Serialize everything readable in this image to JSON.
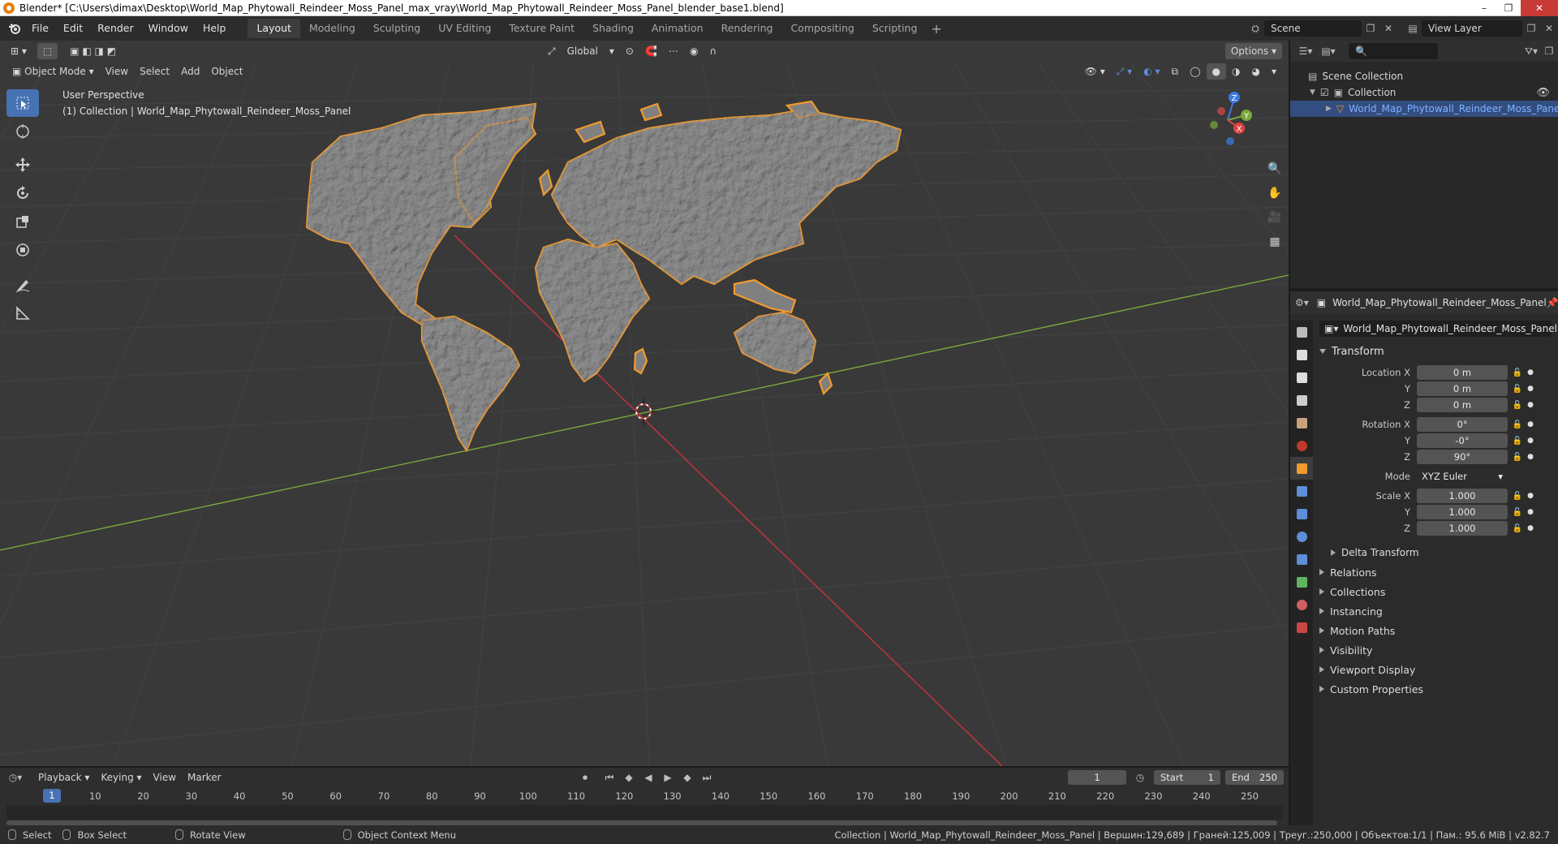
{
  "window": {
    "title": "Blender* [C:\\Users\\dimax\\Desktop\\World_Map_Phytowall_Reindeer_Moss_Panel_max_vray\\World_Map_Phytowall_Reindeer_Moss_Panel_blender_base1.blend]",
    "controls": [
      "–",
      "❐",
      "✕"
    ]
  },
  "menu": [
    "File",
    "Edit",
    "Render",
    "Window",
    "Help"
  ],
  "workspaces": [
    "Layout",
    "Modeling",
    "Sculpting",
    "UV Editing",
    "Texture Paint",
    "Shading",
    "Animation",
    "Rendering",
    "Compositing",
    "Scripting"
  ],
  "active_workspace": "Layout",
  "scene": {
    "name": "Scene",
    "view_layer": "View Layer"
  },
  "viewport": {
    "mode": "Object Mode",
    "menus": [
      "View",
      "Select",
      "Add",
      "Object"
    ],
    "orientation": "Global",
    "options_label": "Options",
    "perspective_label": "User Perspective",
    "collection_label": "(1) Collection | World_Map_Phytowall_Reindeer_Moss_Panel",
    "gizmo": {
      "x": "X",
      "y": "Y",
      "z": "Z"
    }
  },
  "outliner": {
    "scene_collection": "Scene Collection",
    "collection": "Collection",
    "object": "World_Map_Phytowall_Reindeer_Moss_Panel"
  },
  "properties": {
    "header_name": "World_Map_Phytowall_Reindeer_Moss_Panel",
    "object_name": "World_Map_Phytowall_Reindeer_Moss_Panel",
    "transform_title": "Transform",
    "location": {
      "label": "Location X",
      "x": "0 m",
      "y": "0 m",
      "z": "0 m"
    },
    "rotation": {
      "label": "Rotation X",
      "x": "0°",
      "y": "-0°",
      "z": "90°"
    },
    "mode": {
      "label": "Mode",
      "value": "XYZ Euler"
    },
    "scale": {
      "label": "Scale X",
      "x": "1.000",
      "y": "1.000",
      "z": "1.000"
    },
    "axis_y": "Y",
    "axis_z": "Z",
    "delta_transform": "Delta Transform",
    "panels": [
      "Relations",
      "Collections",
      "Instancing",
      "Motion Paths",
      "Visibility",
      "Viewport Display",
      "Custom Properties"
    ]
  },
  "timeline": {
    "menus": [
      "Playback",
      "Keying",
      "View",
      "Marker"
    ],
    "current_frame": "1",
    "start_label": "Start",
    "start": "1",
    "end_label": "End",
    "end": "250",
    "ruler": [
      "1",
      "10",
      "20",
      "30",
      "40",
      "50",
      "60",
      "70",
      "80",
      "90",
      "100",
      "110",
      "120",
      "130",
      "140",
      "150",
      "160",
      "170",
      "180",
      "190",
      "200",
      "210",
      "220",
      "230",
      "240",
      "250"
    ]
  },
  "statusbar": {
    "select": "Select",
    "box_select": "Box Select",
    "rotate_view": "Rotate View",
    "context_menu": "Object Context Menu",
    "stats": "Collection | World_Map_Phytowall_Reindeer_Moss_Panel | Вершин:129,689 | Граней:125,009 | Треуг.:250,000 | Объектов:1/1 | Пам.: 95.6 MiB | v2.82.7"
  },
  "colors": {
    "accent": "#4772b3",
    "selection_outline": "#f29a2e",
    "x_axis": "#c7343c",
    "y_axis": "#7ba83a",
    "viewport_bg": "#393939"
  }
}
